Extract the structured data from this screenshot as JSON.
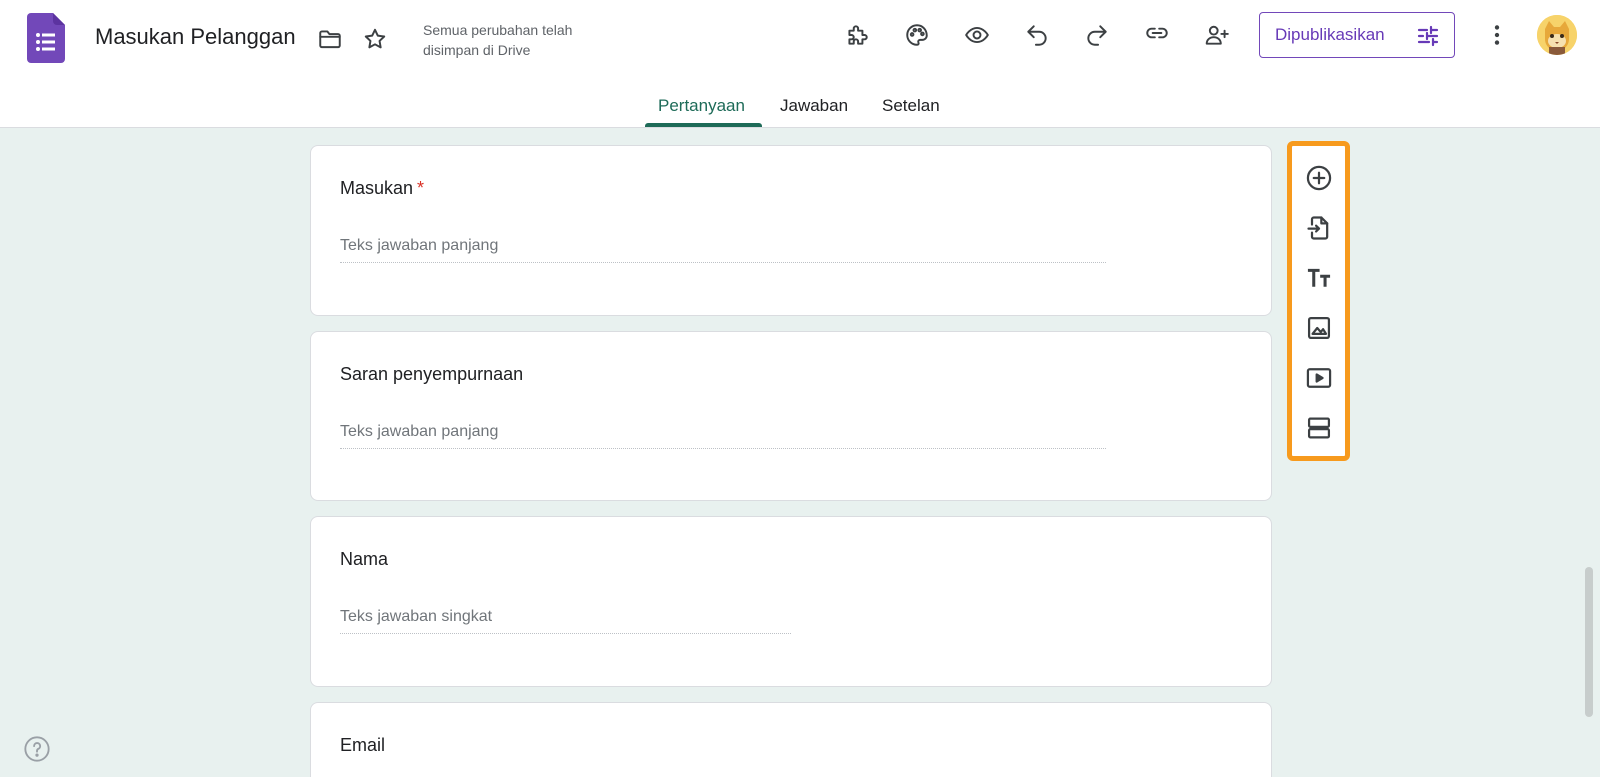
{
  "header": {
    "title": "Masukan Pelanggan",
    "save_status_line1": "Semua perubahan telah",
    "save_status_line2": "disimpan di Drive",
    "publish_label": "Dipublikasikan"
  },
  "tabs": [
    {
      "label": "Pertanyaan",
      "active": true
    },
    {
      "label": "Jawaban",
      "active": false
    },
    {
      "label": "Setelan",
      "active": false
    }
  ],
  "questions": [
    {
      "title": "Masukan",
      "required": "*",
      "answer_placeholder": "Teks jawaban panjang"
    },
    {
      "title": "Saran penyempurnaan",
      "answer_placeholder": "Teks jawaban panjang"
    },
    {
      "title": "Nama",
      "answer_placeholder": "Teks jawaban singkat"
    },
    {
      "title": "Email"
    }
  ],
  "toolbar_icons": [
    "add-question-icon",
    "import-questions-icon",
    "add-title-icon",
    "add-image-icon",
    "add-video-icon",
    "add-section-icon"
  ],
  "colors": {
    "brand_purple": "#673ab7",
    "tab_active": "#1e6b58",
    "background": "#e8f1ef",
    "highlight": "#f79a1d",
    "required": "#d93025"
  }
}
